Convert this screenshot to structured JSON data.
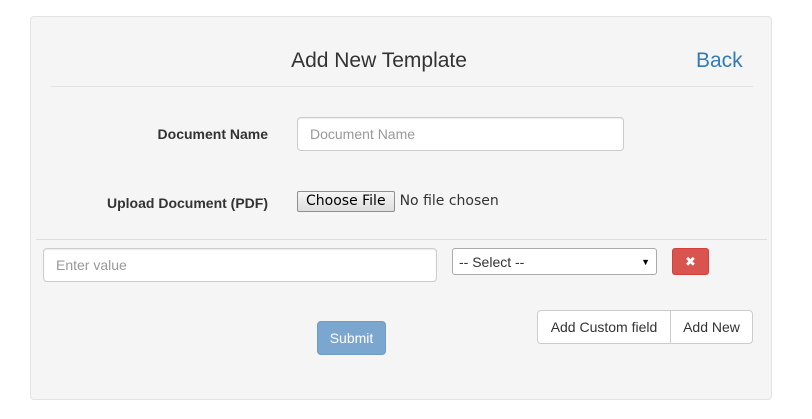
{
  "header": {
    "title": "Add New Template",
    "back_label": "Back"
  },
  "form": {
    "document_name": {
      "label": "Document Name",
      "value": "",
      "placeholder": "Document Name"
    },
    "upload": {
      "label": "Upload Document (PDF)",
      "button_label": "Choose File",
      "status": "No file chosen"
    }
  },
  "custom_field": {
    "value_input": {
      "value": "",
      "placeholder": "Enter value"
    },
    "type_select": {
      "selected": "-- Select --"
    },
    "remove_icon": "times-icon"
  },
  "actions": {
    "submit_label": "Submit",
    "add_custom_field_label": "Add Custom field",
    "add_new_label": "Add New"
  },
  "colors": {
    "link": "#337ab7",
    "danger": "#d9534f",
    "primary_disabled": "#7ba6cf",
    "panel_bg": "#f5f5f5"
  }
}
